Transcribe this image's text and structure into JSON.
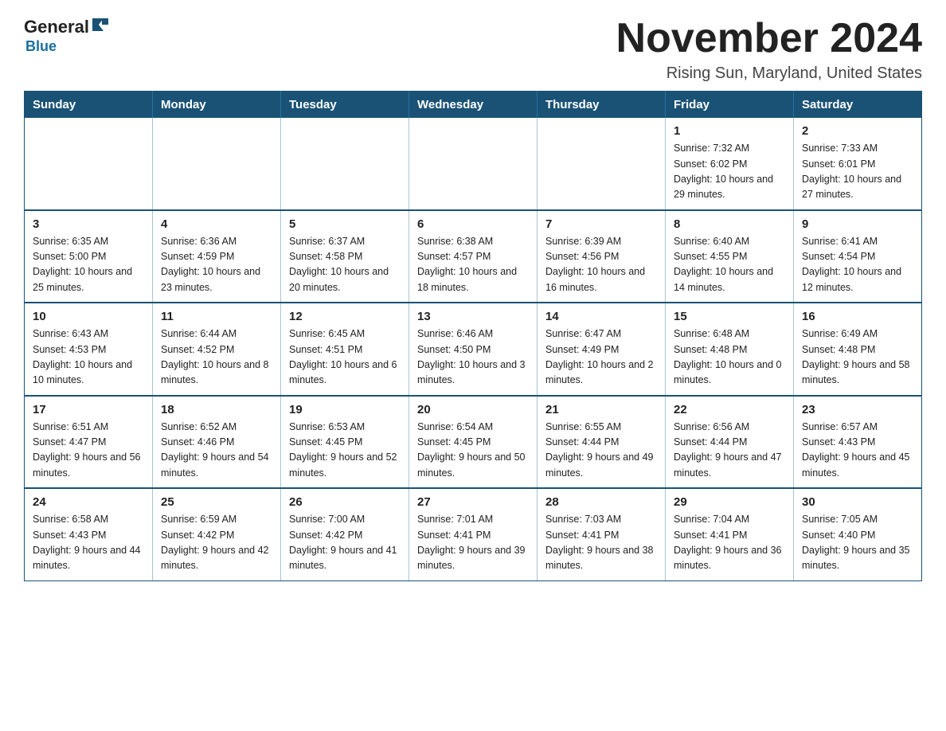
{
  "logo": {
    "general": "General",
    "blue": "Blue",
    "tagline": "Blue"
  },
  "title": "November 2024",
  "location": "Rising Sun, Maryland, United States",
  "days_of_week": [
    "Sunday",
    "Monday",
    "Tuesday",
    "Wednesday",
    "Thursday",
    "Friday",
    "Saturday"
  ],
  "weeks": [
    [
      {
        "day": "",
        "info": ""
      },
      {
        "day": "",
        "info": ""
      },
      {
        "day": "",
        "info": ""
      },
      {
        "day": "",
        "info": ""
      },
      {
        "day": "",
        "info": ""
      },
      {
        "day": "1",
        "info": "Sunrise: 7:32 AM\nSunset: 6:02 PM\nDaylight: 10 hours and 29 minutes."
      },
      {
        "day": "2",
        "info": "Sunrise: 7:33 AM\nSunset: 6:01 PM\nDaylight: 10 hours and 27 minutes."
      }
    ],
    [
      {
        "day": "3",
        "info": "Sunrise: 6:35 AM\nSunset: 5:00 PM\nDaylight: 10 hours and 25 minutes."
      },
      {
        "day": "4",
        "info": "Sunrise: 6:36 AM\nSunset: 4:59 PM\nDaylight: 10 hours and 23 minutes."
      },
      {
        "day": "5",
        "info": "Sunrise: 6:37 AM\nSunset: 4:58 PM\nDaylight: 10 hours and 20 minutes."
      },
      {
        "day": "6",
        "info": "Sunrise: 6:38 AM\nSunset: 4:57 PM\nDaylight: 10 hours and 18 minutes."
      },
      {
        "day": "7",
        "info": "Sunrise: 6:39 AM\nSunset: 4:56 PM\nDaylight: 10 hours and 16 minutes."
      },
      {
        "day": "8",
        "info": "Sunrise: 6:40 AM\nSunset: 4:55 PM\nDaylight: 10 hours and 14 minutes."
      },
      {
        "day": "9",
        "info": "Sunrise: 6:41 AM\nSunset: 4:54 PM\nDaylight: 10 hours and 12 minutes."
      }
    ],
    [
      {
        "day": "10",
        "info": "Sunrise: 6:43 AM\nSunset: 4:53 PM\nDaylight: 10 hours and 10 minutes."
      },
      {
        "day": "11",
        "info": "Sunrise: 6:44 AM\nSunset: 4:52 PM\nDaylight: 10 hours and 8 minutes."
      },
      {
        "day": "12",
        "info": "Sunrise: 6:45 AM\nSunset: 4:51 PM\nDaylight: 10 hours and 6 minutes."
      },
      {
        "day": "13",
        "info": "Sunrise: 6:46 AM\nSunset: 4:50 PM\nDaylight: 10 hours and 3 minutes."
      },
      {
        "day": "14",
        "info": "Sunrise: 6:47 AM\nSunset: 4:49 PM\nDaylight: 10 hours and 2 minutes."
      },
      {
        "day": "15",
        "info": "Sunrise: 6:48 AM\nSunset: 4:48 PM\nDaylight: 10 hours and 0 minutes."
      },
      {
        "day": "16",
        "info": "Sunrise: 6:49 AM\nSunset: 4:48 PM\nDaylight: 9 hours and 58 minutes."
      }
    ],
    [
      {
        "day": "17",
        "info": "Sunrise: 6:51 AM\nSunset: 4:47 PM\nDaylight: 9 hours and 56 minutes."
      },
      {
        "day": "18",
        "info": "Sunrise: 6:52 AM\nSunset: 4:46 PM\nDaylight: 9 hours and 54 minutes."
      },
      {
        "day": "19",
        "info": "Sunrise: 6:53 AM\nSunset: 4:45 PM\nDaylight: 9 hours and 52 minutes."
      },
      {
        "day": "20",
        "info": "Sunrise: 6:54 AM\nSunset: 4:45 PM\nDaylight: 9 hours and 50 minutes."
      },
      {
        "day": "21",
        "info": "Sunrise: 6:55 AM\nSunset: 4:44 PM\nDaylight: 9 hours and 49 minutes."
      },
      {
        "day": "22",
        "info": "Sunrise: 6:56 AM\nSunset: 4:44 PM\nDaylight: 9 hours and 47 minutes."
      },
      {
        "day": "23",
        "info": "Sunrise: 6:57 AM\nSunset: 4:43 PM\nDaylight: 9 hours and 45 minutes."
      }
    ],
    [
      {
        "day": "24",
        "info": "Sunrise: 6:58 AM\nSunset: 4:43 PM\nDaylight: 9 hours and 44 minutes."
      },
      {
        "day": "25",
        "info": "Sunrise: 6:59 AM\nSunset: 4:42 PM\nDaylight: 9 hours and 42 minutes."
      },
      {
        "day": "26",
        "info": "Sunrise: 7:00 AM\nSunset: 4:42 PM\nDaylight: 9 hours and 41 minutes."
      },
      {
        "day": "27",
        "info": "Sunrise: 7:01 AM\nSunset: 4:41 PM\nDaylight: 9 hours and 39 minutes."
      },
      {
        "day": "28",
        "info": "Sunrise: 7:03 AM\nSunset: 4:41 PM\nDaylight: 9 hours and 38 minutes."
      },
      {
        "day": "29",
        "info": "Sunrise: 7:04 AM\nSunset: 4:41 PM\nDaylight: 9 hours and 36 minutes."
      },
      {
        "day": "30",
        "info": "Sunrise: 7:05 AM\nSunset: 4:40 PM\nDaylight: 9 hours and 35 minutes."
      }
    ]
  ]
}
